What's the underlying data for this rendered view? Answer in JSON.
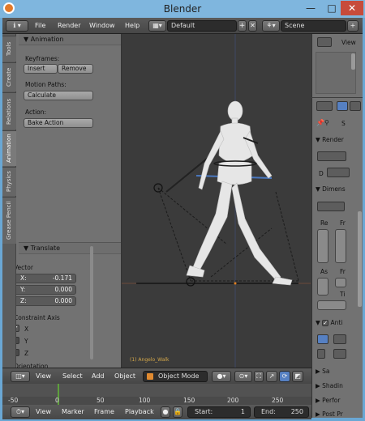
{
  "window": {
    "title": "Blender",
    "minimize": "—",
    "maximize": "□",
    "close": "✕"
  },
  "info_header": {
    "menus": [
      "File",
      "Render",
      "Window",
      "Help"
    ],
    "screen_layout": "Default",
    "scene": "Scene"
  },
  "tool_tabs": [
    "Tools",
    "Create",
    "Relations",
    "Animation",
    "Physics",
    "Grease Pencil"
  ],
  "animation_panel": {
    "title": "Animation",
    "keyframes_label": "Keyframes:",
    "insert": "Insert",
    "remove": "Remove",
    "motion_paths_label": "Motion Paths:",
    "calculate": "Calculate",
    "action_label": "Action:",
    "bake_action": "Bake Action"
  },
  "translate_panel": {
    "title": "Translate",
    "vector_label": "Vector",
    "x_label": "X:",
    "x_value": "-0.171",
    "y_label": "Y:",
    "y_value": "0.000",
    "z_label": "Z:",
    "z_value": "0.000",
    "constraint_label": "Constraint Axis",
    "axes": [
      "X",
      "Y",
      "Z"
    ],
    "orientation_label": "Orientation"
  },
  "viewport": {
    "object_label": "(1) Angelo_Walk"
  },
  "view3d_header": {
    "menus": [
      "View",
      "Select",
      "Add",
      "Object"
    ],
    "mode": "Object Mode"
  },
  "timeline": {
    "ticks": [
      "-50",
      "0",
      "50",
      "100",
      "150",
      "200",
      "250"
    ]
  },
  "timeline_header": {
    "menus": [
      "View",
      "Marker",
      "Frame",
      "Playback"
    ],
    "start_label": "Start:",
    "start_value": "1",
    "end_label": "End:",
    "end_value": "250"
  },
  "outliner": {
    "view_label": "View"
  },
  "properties": {
    "sections": [
      "Render",
      "Dimens",
      "Anti",
      "Sa",
      "Shadin",
      "Perfor",
      "Post Pr"
    ],
    "labels": {
      "render_d": "D",
      "re": "Re",
      "fr": "Fr",
      "as": "As",
      "fr2": "Fr",
      "ti": "Ti",
      "s": "S"
    }
  },
  "colors": {
    "accent_blue": "#5680c2",
    "panel_gray": "#727272",
    "viewport_gray": "#3b3b3b",
    "titlebar": "#7fb6de"
  }
}
